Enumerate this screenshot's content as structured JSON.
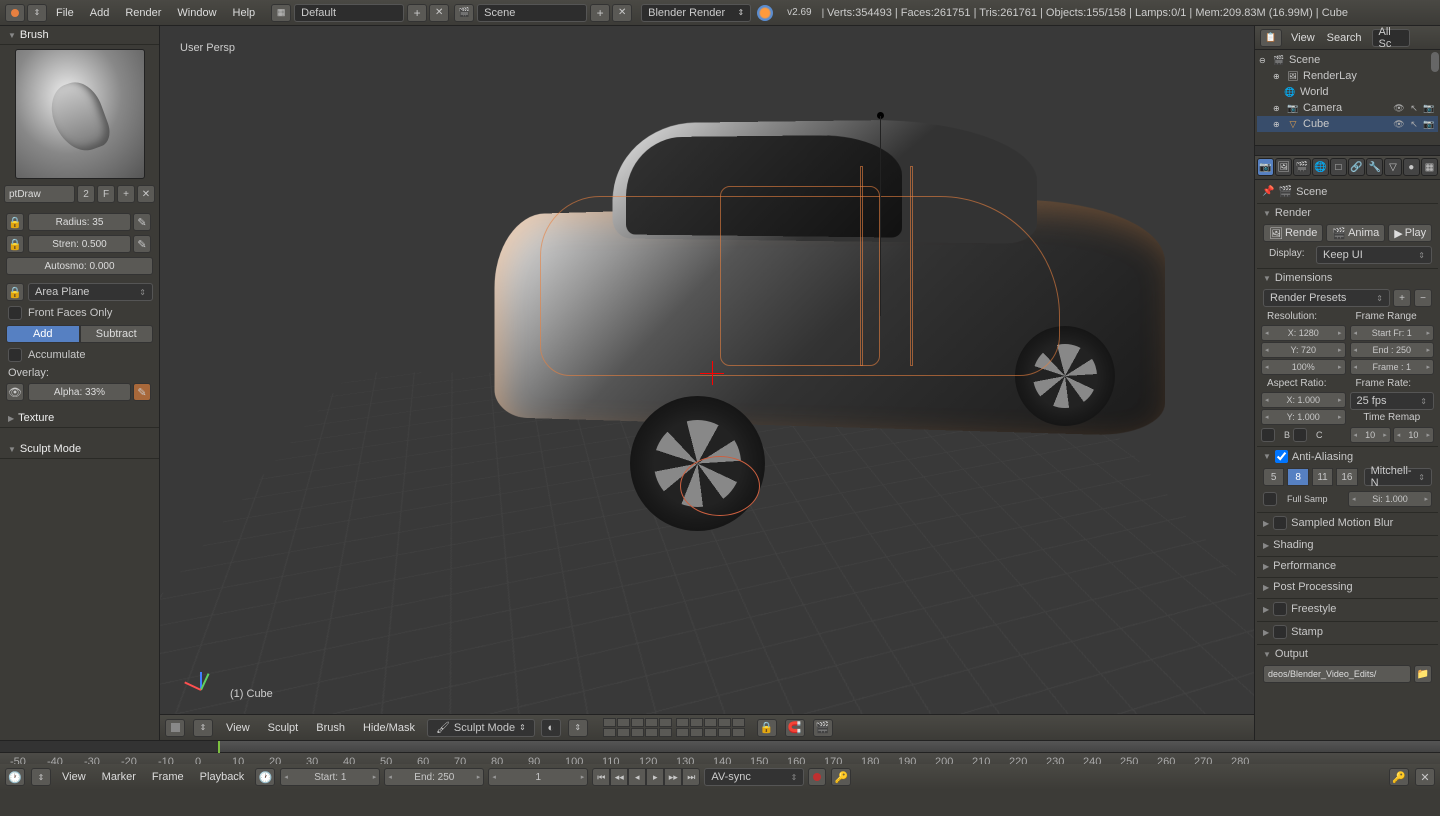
{
  "topbar": {
    "menus": [
      "File",
      "Add",
      "Render",
      "Window",
      "Help"
    ],
    "layout": "Default",
    "scene": "Scene",
    "engine": "Blender Render",
    "version": "v2.69",
    "stats": "Verts:354493 | Faces:261751 | Tris:261761 | Objects:155/158 | Lamps:0/1 | Mem:209.83M (16.99M) | Cube"
  },
  "left": {
    "brush_header": "Brush",
    "brush_name": "ptDraw",
    "brush_users": "2",
    "fake": "F",
    "radius": "Radius: 35",
    "strength": "Stren: 0.500",
    "autosmooth": "Autosmo: 0.000",
    "plane": "Area Plane",
    "front_faces": "Front Faces Only",
    "add": "Add",
    "subtract": "Subtract",
    "accumulate": "Accumulate",
    "overlay": "Overlay:",
    "alpha": "Alpha: 33%",
    "texture": "Texture",
    "sculpt_mode": "Sculpt Mode"
  },
  "viewport": {
    "persp": "User Persp",
    "object": "(1) Cube",
    "menus": [
      "View",
      "Sculpt",
      "Brush",
      "Hide/Mask"
    ],
    "mode": "Sculpt Mode"
  },
  "outliner": {
    "view": "View",
    "search": "Search",
    "allsc": "All Sc",
    "items": [
      {
        "label": "Scene",
        "icon": "🎬"
      },
      {
        "label": "RenderLay",
        "icon": "🖼"
      },
      {
        "label": "World",
        "icon": "🌐"
      },
      {
        "label": "Camera",
        "icon": "📷"
      },
      {
        "label": "Cube",
        "icon": "▽"
      }
    ]
  },
  "properties": {
    "breadcrumb": "Scene",
    "render_header": "Render",
    "render_btn": "Rende",
    "anim_btn": "Anima",
    "play_btn": "Play",
    "display_label": "Display:",
    "display_value": "Keep UI",
    "dimensions_header": "Dimensions",
    "presets": "Render Presets",
    "resolution_label": "Resolution:",
    "frame_range_label": "Frame Range",
    "res_x": "X: 1280",
    "res_y": "Y: 720",
    "res_pct": "100%",
    "start_fr": "Start Fr: 1",
    "end_fr": "End : 250",
    "frame_step": "Frame : 1",
    "aspect_label": "Aspect Ratio:",
    "frame_rate_label": "Frame Rate:",
    "aspect_x": "X: 1.000",
    "aspect_y": "Y: 1.000",
    "fps": "25 fps",
    "time_remap": "Time Remap",
    "border_b": "B",
    "border_c": "C",
    "remap_old": "10",
    "remap_new": "10",
    "aa_header": "Anti-Aliasing",
    "aa_samples": [
      "5",
      "8",
      "11",
      "16"
    ],
    "aa_filter": "Mitchell-N",
    "full_sample": "Full Samp",
    "aa_size": "Si: 1.000",
    "collapsed": [
      "Sampled Motion Blur",
      "Shading",
      "Performance",
      "Post Processing",
      "Freestyle",
      "Stamp",
      "Output"
    ],
    "output_path": "deos/Blender_Video_Edits/"
  },
  "timeline": {
    "menus": [
      "View",
      "Marker",
      "Frame",
      "Playback"
    ],
    "start": "Start: 1",
    "end": "End: 250",
    "current": "1",
    "sync": "AV-sync",
    "ticks": [
      "-50",
      "-40",
      "-30",
      "-20",
      "-10",
      "0",
      "10",
      "20",
      "30",
      "40",
      "50",
      "60",
      "70",
      "80",
      "90",
      "100",
      "110",
      "120",
      "130",
      "140",
      "150",
      "160",
      "170",
      "180",
      "190",
      "200",
      "210",
      "220",
      "230",
      "240",
      "250",
      "260",
      "270",
      "280"
    ]
  }
}
